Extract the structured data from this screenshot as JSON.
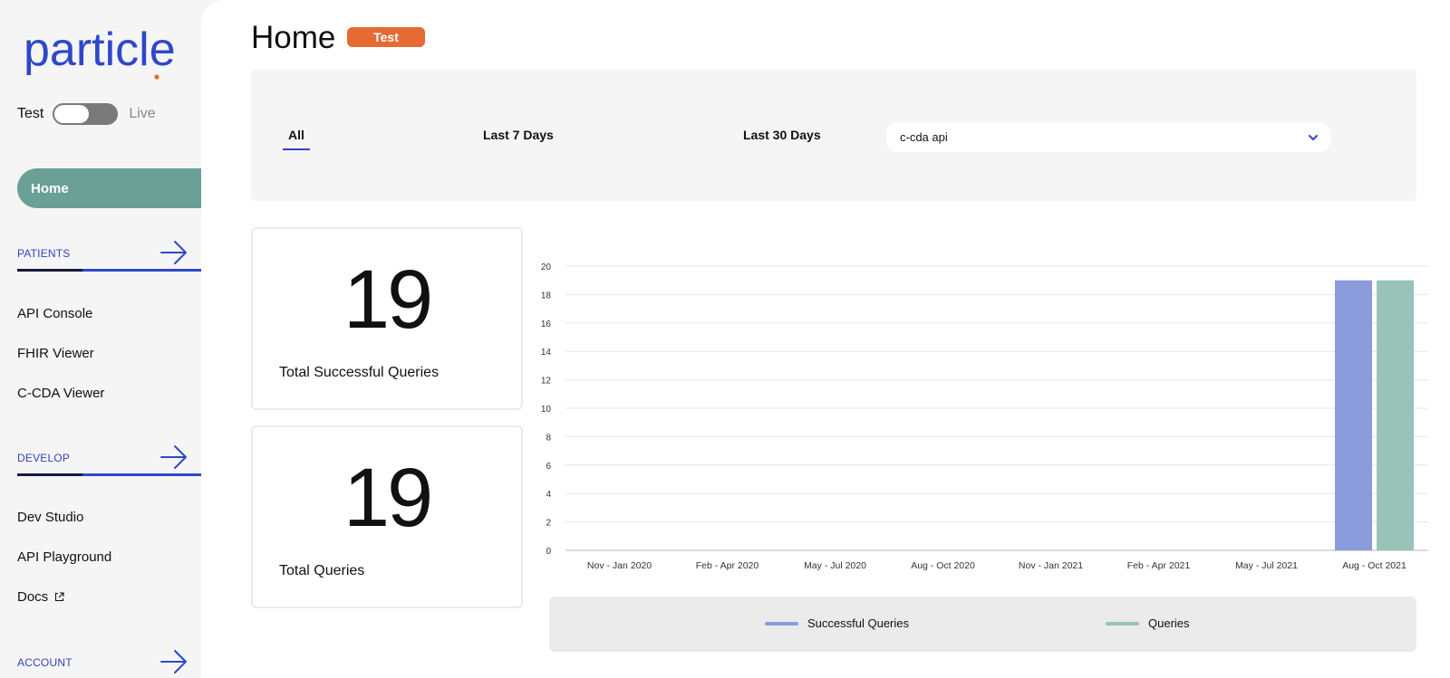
{
  "sidebar": {
    "logo_text": "particle",
    "env_toggle": {
      "left_label": "Test",
      "right_label": "Live",
      "state": "Test"
    },
    "home_label": "Home",
    "sections": [
      {
        "title": "PATIENTS",
        "items": [
          "API Console",
          "FHIR Viewer",
          "C-CDA Viewer"
        ]
      },
      {
        "title": "DEVELOP",
        "items": [
          "Dev Studio",
          "API Playground",
          "Docs"
        ]
      },
      {
        "title": "ACCOUNT",
        "items": []
      }
    ]
  },
  "header": {
    "title": "Home",
    "env_badge": "Test"
  },
  "filters": {
    "tabs": [
      "All",
      "Last 7 Days",
      "Last 30 Days"
    ],
    "active_tab": "All",
    "source_select": {
      "value": "c-cda api"
    }
  },
  "stats": [
    {
      "value": "19",
      "label": "Total Successful Queries"
    },
    {
      "value": "19",
      "label": "Total Queries"
    }
  ],
  "colors": {
    "accent": "#3344bb",
    "home_pill": "#6aa096",
    "badge": "#e56a33",
    "series_successful": "#8b9bdc",
    "series_queries": "#99c2b8"
  },
  "chart_data": {
    "type": "bar",
    "categories": [
      "Nov - Jan 2020",
      "Feb - Apr 2020",
      "May - Jul 2020",
      "Aug - Oct 2020",
      "Nov - Jan 2021",
      "Feb - Apr 2021",
      "May - Jul 2021",
      "Aug - Oct 2021"
    ],
    "series": [
      {
        "name": "Successful Queries",
        "values": [
          0,
          0,
          0,
          0,
          0,
          0,
          0,
          19
        ]
      },
      {
        "name": "Queries",
        "values": [
          0,
          0,
          0,
          0,
          0,
          0,
          0,
          19
        ]
      }
    ],
    "yticks": [
      0,
      2,
      4,
      6,
      8,
      10,
      12,
      14,
      16,
      18,
      20
    ],
    "ylim": [
      0,
      20
    ],
    "grid": true,
    "legend_position": "bottom"
  }
}
